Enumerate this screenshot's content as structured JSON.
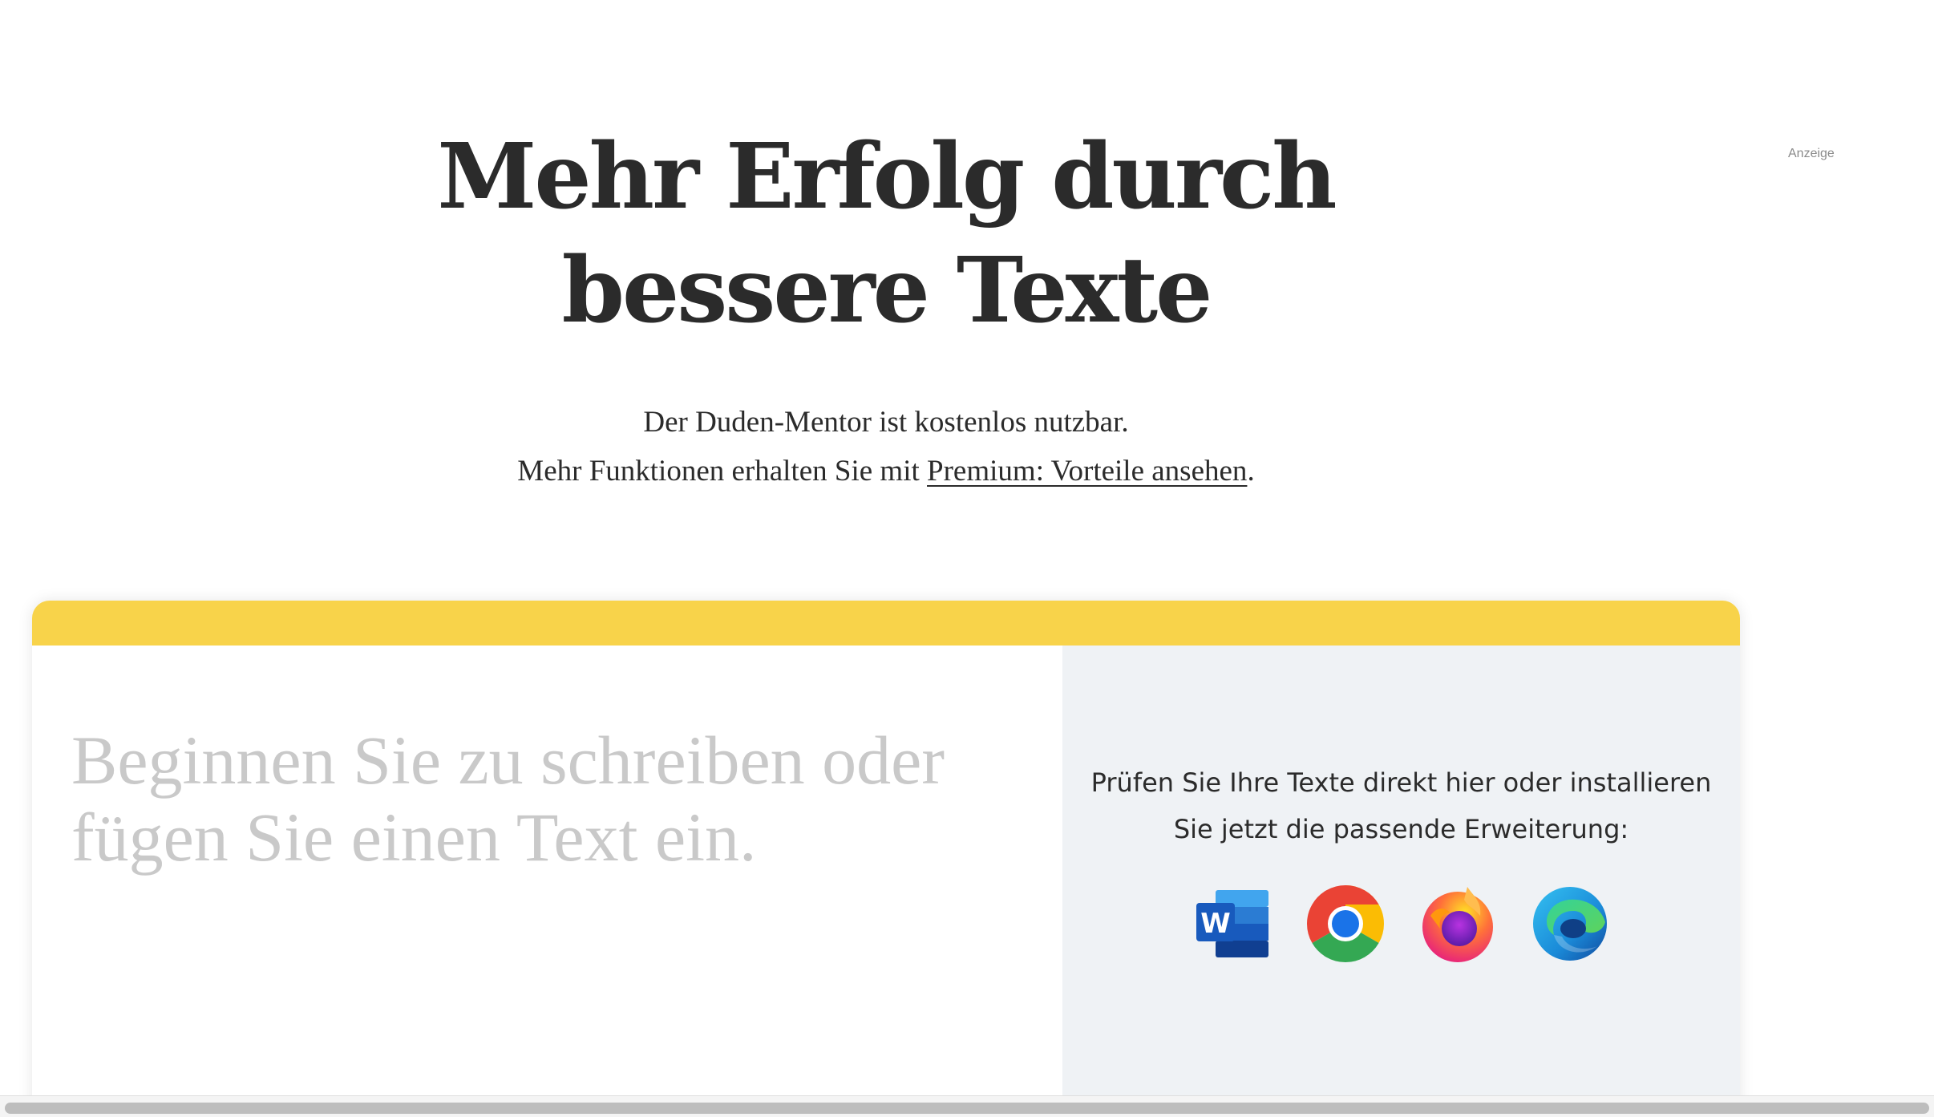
{
  "ad": {
    "label": "Anzeige"
  },
  "hero": {
    "headline_line1": "Mehr Erfolg durch",
    "headline_line2": "bessere Texte",
    "sub_line1": "Der Duden-Mentor ist kostenlos nutzbar.",
    "sub_line2_prefix": "Mehr Funktionen erhalten Sie mit ",
    "premium_link": "Premium: Vorteile ansehen",
    "sub_line2_suffix": "."
  },
  "editor": {
    "placeholder": "Beginnen Sie zu schreiben oder fügen Sie einen Text ein.",
    "accent_color": "#f8d34a"
  },
  "extensions": {
    "text_line1": "Prüfen Sie Ihre Texte direkt hier oder installieren",
    "text_line2": "Sie jetzt die passende Erweiterung:",
    "icons": [
      "microsoft-word-icon",
      "chrome-icon",
      "firefox-icon",
      "edge-icon"
    ],
    "word_letter": "W"
  }
}
